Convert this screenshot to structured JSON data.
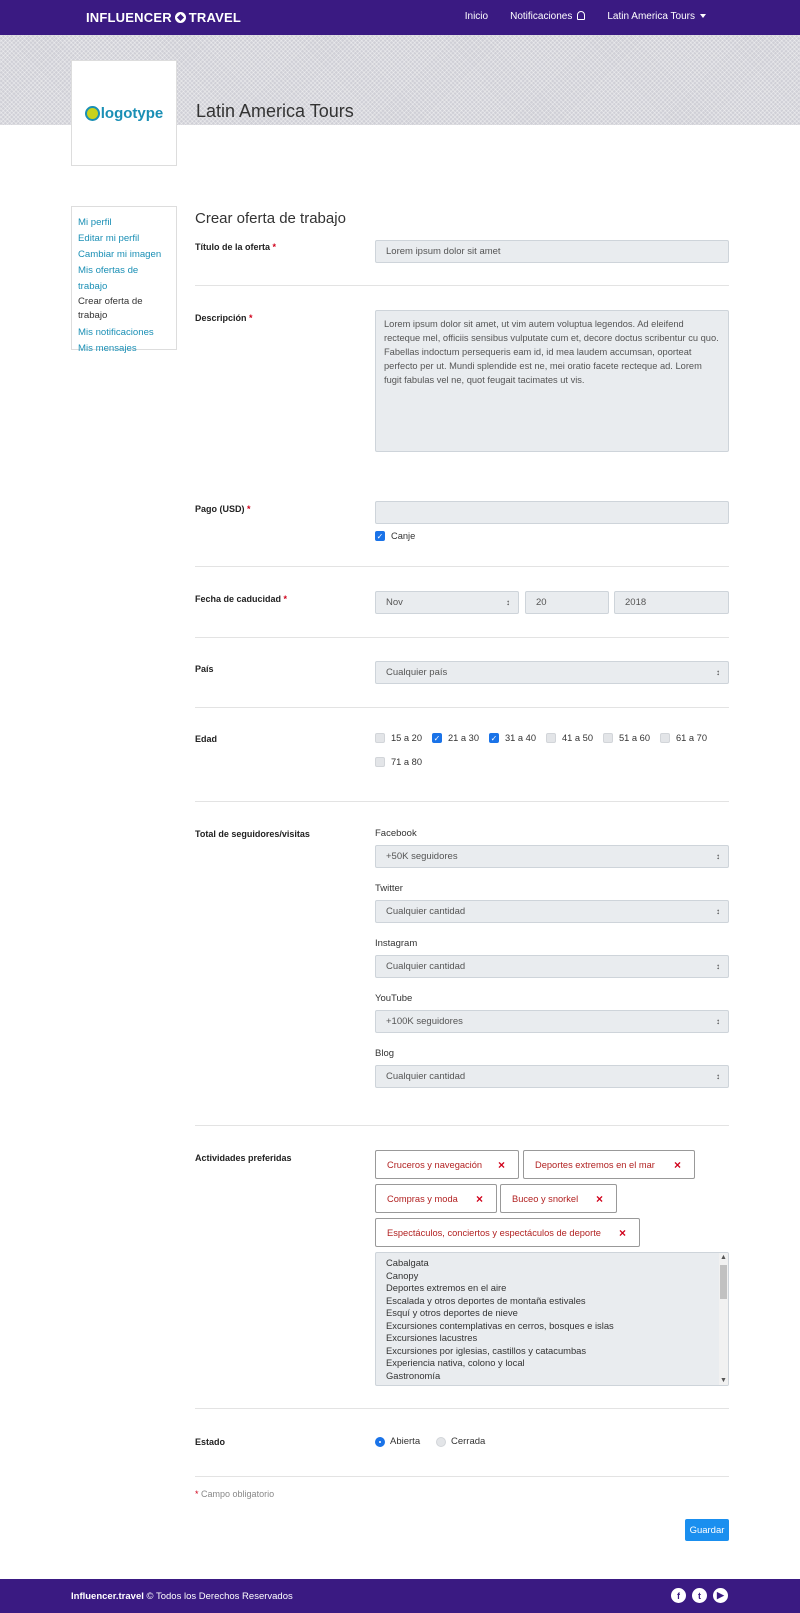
{
  "nav": {
    "brand": "INFLUENCER",
    "brand2": "TRAVEL",
    "inicio": "Inicio",
    "notificaciones": "Notificaciones",
    "account": "Latin America Tours"
  },
  "header": {
    "logo_text_a": "logo",
    "logo_text_b": "type",
    "company": "Latin America Tours"
  },
  "sidebar": {
    "items": [
      {
        "label": "Mi perfil"
      },
      {
        "label": "Editar mi perfil"
      },
      {
        "label": "Cambiar mi imagen"
      },
      {
        "label": "Mis ofertas de trabajo"
      },
      {
        "label": "Crear oferta de trabajo"
      },
      {
        "label": "Mis notificaciones"
      },
      {
        "label": "Mis mensajes"
      }
    ]
  },
  "form": {
    "title": "Crear oferta de trabajo",
    "required_mark": "*",
    "titulo_label": "Título de la oferta",
    "titulo_value": "Lorem ipsum dolor sit amet",
    "descripcion_label": "Descripción",
    "descripcion_value": "Lorem ipsum dolor sit amet, ut vim autem voluptua legendos. Ad eleifend recteque mel, officiis sensibus vulputate cum et, decore doctus scribentur cu quo. Fabellas indoctum persequeris eam id, id mea laudem accumsan, oporteat perfecto per ut. Mundi splendide est ne, mei oratio facete recteque ad. Lorem fugit fabulas vel ne, quot feugait tacimates ut vis.",
    "pago_label": "Pago (USD)",
    "pago_value": "",
    "canje_label": "Canje",
    "canje_checked": true,
    "fecha_label": "Fecha de caducidad",
    "fecha_month": "Nov",
    "fecha_day": "20",
    "fecha_year": "2018",
    "pais_label": "País",
    "pais_value": "Cualquier país",
    "edad_label": "Edad",
    "edad_options": [
      {
        "label": "15 a 20",
        "checked": false
      },
      {
        "label": "21 a 30",
        "checked": true
      },
      {
        "label": "31 a 40",
        "checked": true
      },
      {
        "label": "41 a 50",
        "checked": false
      },
      {
        "label": "51 a 60",
        "checked": false
      },
      {
        "label": "61 a 70",
        "checked": false
      },
      {
        "label": "71 a 80",
        "checked": false
      }
    ],
    "seguidores_label": "Total de seguidores/visitas",
    "social": [
      {
        "name": "Facebook",
        "value": "+50K seguidores"
      },
      {
        "name": "Twitter",
        "value": "Cualquier cantidad"
      },
      {
        "name": "Instagram",
        "value": "Cualquier cantidad"
      },
      {
        "name": "YouTube",
        "value": "+100K seguidores"
      },
      {
        "name": "Blog",
        "value": "Cualquier cantidad"
      }
    ],
    "actividades_label": "Actividades preferidas",
    "selected_activities": [
      "Cruceros y navegación",
      "Deportes extremos en el mar",
      "Compras y moda",
      "Buceo y snorkel",
      "Espectáculos, conciertos y espectáculos de deporte"
    ],
    "remove_symbol": "×",
    "activity_options": [
      "Cabalgata",
      "Canopy",
      "Deportes extremos en el aire",
      "Escalada y otros deportes de montaña estivales",
      "Esquí y otros deportes de nieve",
      "Excursiones contemplativas en cerros, bosques e islas",
      "Excursiones lacustres",
      "Excursiones por iglesias, castillos y catacumbas",
      "Experiencia nativa, colono y local",
      "Gastronomía"
    ],
    "estado_label": "Estado",
    "estado_options": [
      {
        "label": "Abierta",
        "selected": true
      },
      {
        "label": "Cerrada",
        "selected": false
      }
    ],
    "footnote": "Campo obligatorio",
    "save_label": "Guardar"
  },
  "footer": {
    "site": "Influencer.travel",
    "rights": "© Todos los Derechos Reservados",
    "icons": [
      "facebook-icon",
      "twitter-icon",
      "youtube-icon"
    ]
  }
}
